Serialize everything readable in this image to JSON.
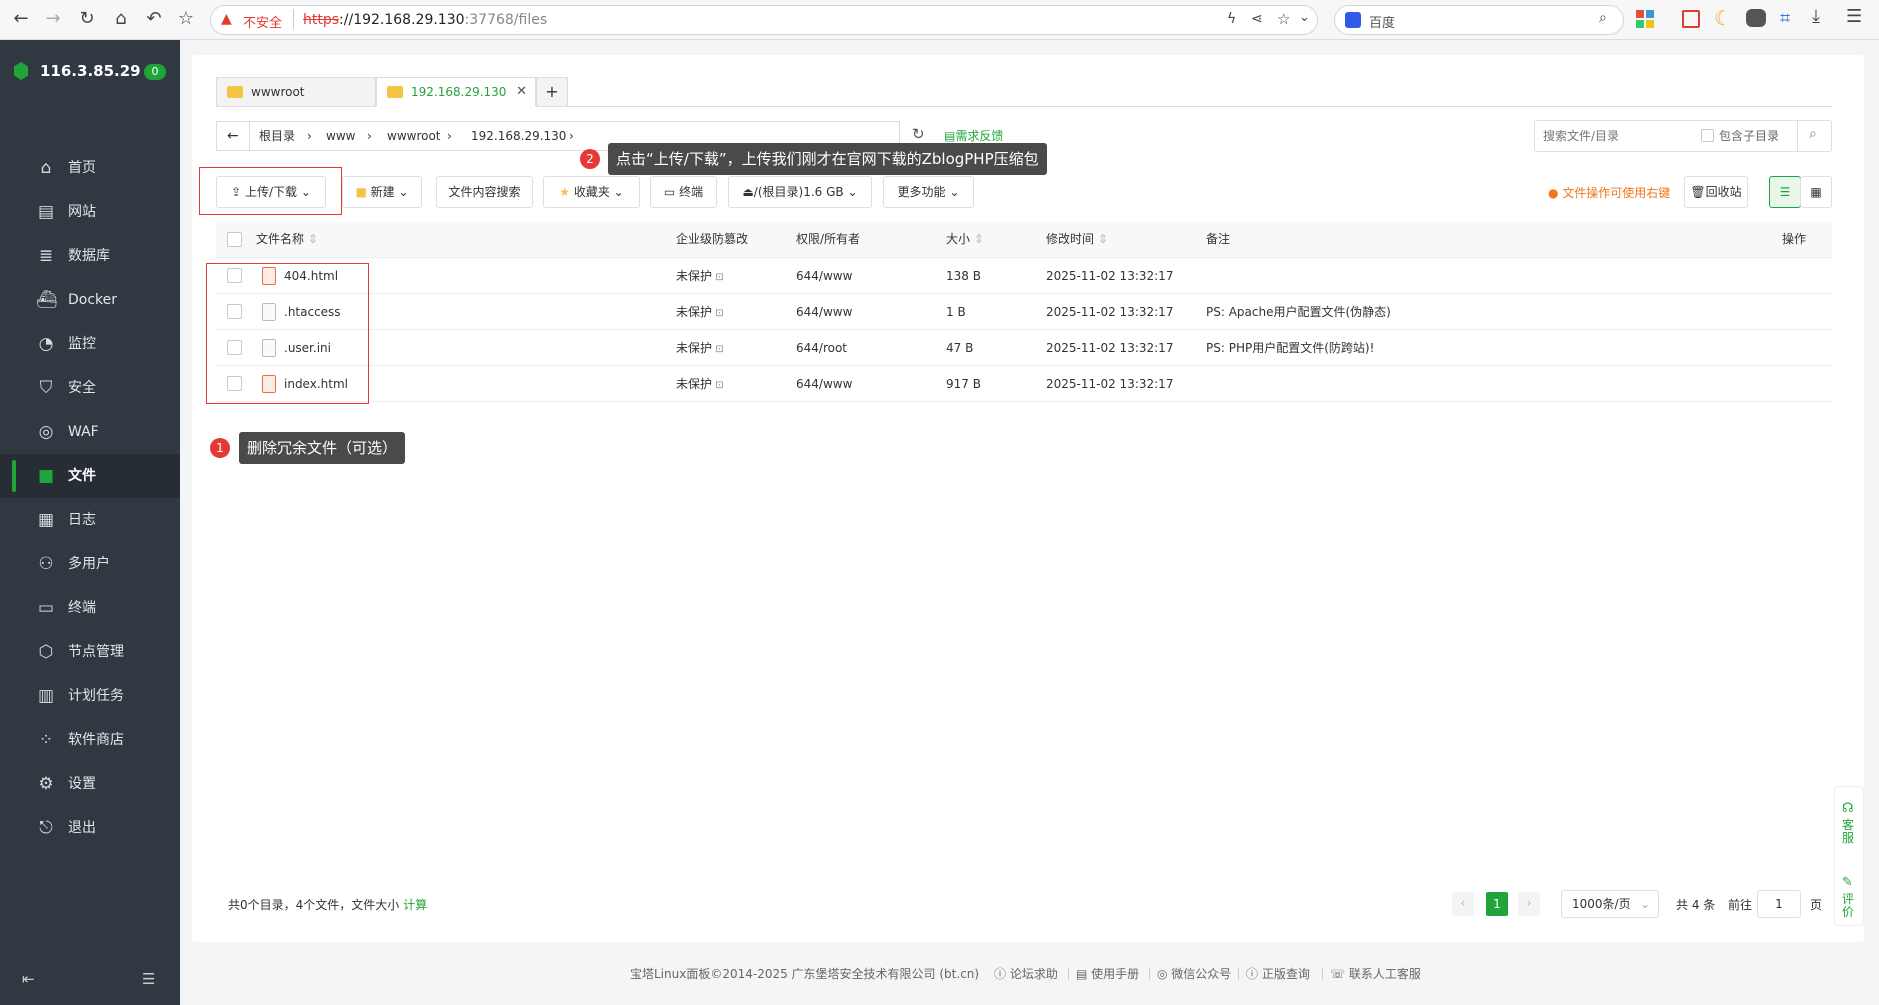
{
  "browser": {
    "insecure_label": "不安全",
    "url_scheme": "https",
    "url_host": "://192.168.29.130",
    "url_rest": ":37768/files",
    "search_engine": "百度"
  },
  "sidebar": {
    "server_ip": "116.3.85.29",
    "badge_count": "0",
    "items": [
      {
        "label": "首页",
        "icon": "home-icon"
      },
      {
        "label": "网站",
        "icon": "website-icon"
      },
      {
        "label": "数据库",
        "icon": "database-icon"
      },
      {
        "label": "Docker",
        "icon": "docker-icon"
      },
      {
        "label": "监控",
        "icon": "monitor-icon"
      },
      {
        "label": "安全",
        "icon": "shield-icon"
      },
      {
        "label": "WAF",
        "icon": "waf-icon"
      },
      {
        "label": "文件",
        "icon": "folder-icon"
      },
      {
        "label": "日志",
        "icon": "log-icon"
      },
      {
        "label": "多用户",
        "icon": "users-icon"
      },
      {
        "label": "终端",
        "icon": "terminal-icon"
      },
      {
        "label": "节点管理",
        "icon": "node-icon"
      },
      {
        "label": "计划任务",
        "icon": "calendar-icon"
      },
      {
        "label": "软件商店",
        "icon": "store-icon"
      },
      {
        "label": "设置",
        "icon": "gear-icon"
      },
      {
        "label": "退出",
        "icon": "logout-icon"
      }
    ],
    "active_index": 7
  },
  "tabs": [
    {
      "label": "wwwroot"
    },
    {
      "label": "192.168.29.130"
    }
  ],
  "breadcrumb": {
    "items": [
      "根目录",
      "www",
      "wwwroot",
      "192.168.29.130"
    ],
    "feedback": "需求反馈"
  },
  "search": {
    "placeholder": "搜索文件/目录",
    "include_sub_label": "包含子目录"
  },
  "toolbar": {
    "upload": "上传/下载",
    "new": "新建",
    "content_search": "文件内容搜索",
    "favorites": "收藏夹",
    "terminal": "终端",
    "disk": "/(根目录)1.6 GB",
    "more": "更多功能",
    "right_click_tip": "文件操作可使用右键",
    "recycle": "回收站"
  },
  "table": {
    "headers": {
      "name": "文件名称",
      "protect": "企业级防篡改",
      "perm": "权限/所有者",
      "size": "大小",
      "mtime": "修改时间",
      "note": "备注",
      "ops": "操作"
    },
    "rows": [
      {
        "name": "404.html",
        "protect": "未保护",
        "perm": "644/www",
        "size": "138 B",
        "mtime": "2025-11-02 13:32:17",
        "note": "",
        "type": "html"
      },
      {
        "name": ".htaccess",
        "protect": "未保护",
        "perm": "644/www",
        "size": "1 B",
        "mtime": "2025-11-02 13:32:17",
        "note": "PS: Apache用户配置文件(伪静态)",
        "type": "text"
      },
      {
        "name": ".user.ini",
        "protect": "未保护",
        "perm": "644/root",
        "size": "47 B",
        "mtime": "2025-11-02 13:32:17",
        "note": "PS: PHP用户配置文件(防跨站)!",
        "type": "text"
      },
      {
        "name": "index.html",
        "protect": "未保护",
        "perm": "644/www",
        "size": "917 B",
        "mtime": "2025-11-02 13:32:17",
        "note": "",
        "type": "html"
      }
    ]
  },
  "annotations": {
    "a1_num": "1",
    "a1_text": "删除冗余文件（可选）",
    "a2_num": "2",
    "a2_text": "点击“上传/下载”，上传我们刚才在官网下载的ZblogPHP压缩包"
  },
  "summary": {
    "text": "共0个目录，4个文件，文件大小",
    "calc": "计算"
  },
  "pagination": {
    "current": "1",
    "per_page": "1000条/页",
    "total": "共 4 条",
    "goto_prefix": "前往",
    "goto_value": "1",
    "goto_suffix": "页"
  },
  "float": {
    "service": "客服",
    "rate": "评价"
  },
  "footer": {
    "copyright": "宝塔Linux面板©2014-2025 广东堡塔安全技术有限公司 (bt.cn)",
    "links": [
      "论坛求助",
      "使用手册",
      "微信公众号",
      "正版查询",
      "联系人工客服"
    ]
  },
  "colors": {
    "accent": "#20a53a",
    "sidebar_bg": "#303841",
    "warning": "#f0761d",
    "annotation_red": "#e53935"
  }
}
